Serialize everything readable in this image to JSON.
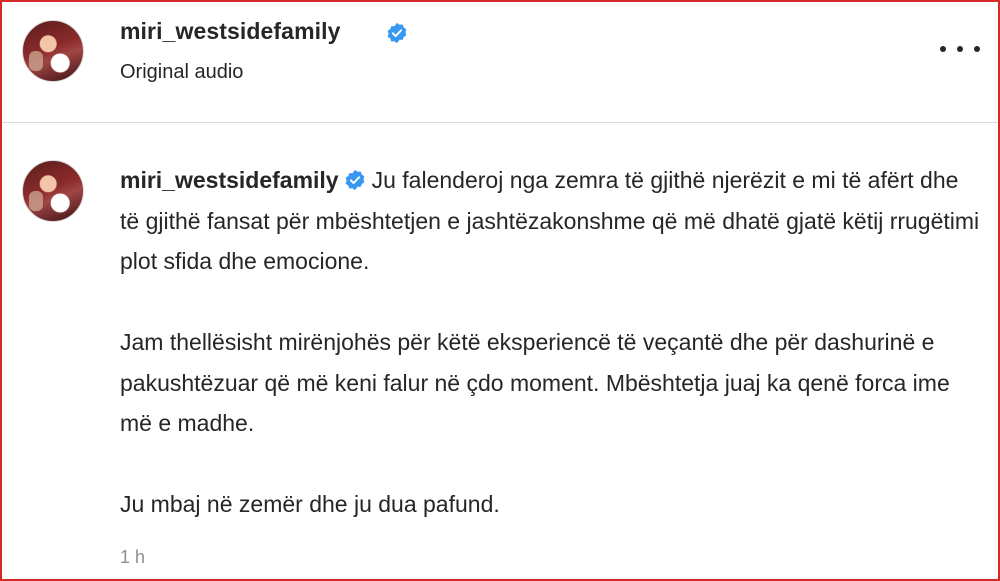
{
  "post": {
    "username": "miri_westsidefamily",
    "verified": true,
    "audio_label": "Original audio",
    "more_icon": "more-horizontal-icon",
    "badge_color": "#3897f0"
  },
  "caption": {
    "username": "miri_westsidefamily",
    "paragraph_1": "Ju falenderoj nga zemra të gjithë njerëzit e mi të afërt dhe të gjithë fansat për mbështetjen e jashtëzakonshme që më dhatë gjatë këtij rrugëtimi plot sfida dhe emocione.",
    "paragraph_2": "Jam thellësisht mirënjohës për këtë eksperiencë të veçantë dhe për dashurinë e pakushtëzuar që më keni falur në çdo moment. Mbështetja juaj ka qenë forca ime më e madhe.",
    "paragraph_3": "Ju mbaj në zemër dhe ju dua pafund.",
    "timestamp": "1 h"
  }
}
